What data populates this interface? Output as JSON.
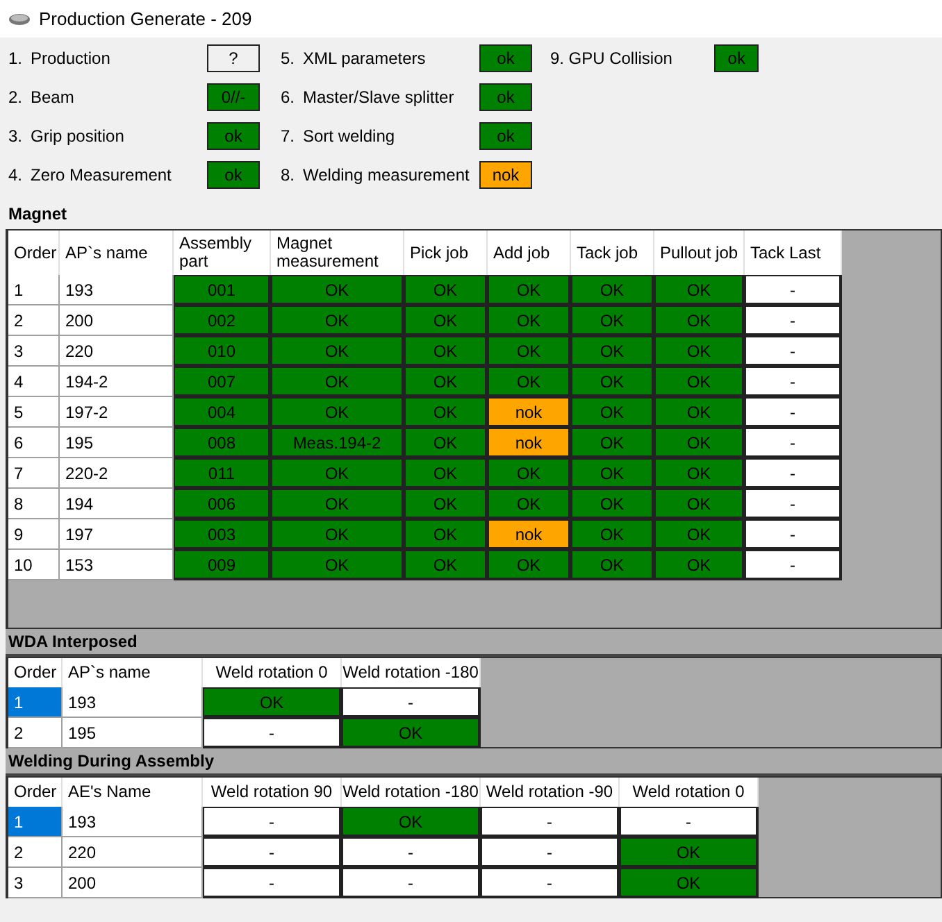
{
  "window": {
    "title": "Production Generate - 209"
  },
  "checks": [
    {
      "number": "1.",
      "label": "Production",
      "value": "?",
      "color": "#f0f0f0"
    },
    {
      "number": "2.",
      "label": "Beam",
      "value": "0//-",
      "color": "#008000"
    },
    {
      "number": "3.",
      "label": "Grip position",
      "value": "ok",
      "color": "#008000"
    },
    {
      "number": "4.",
      "label": "Zero Measurement",
      "value": "ok",
      "color": "#008000"
    },
    {
      "number": "5.",
      "label": "XML parameters",
      "value": "ok",
      "color": "#008000"
    },
    {
      "number": "6.",
      "label": "Master/Slave splitter",
      "value": "ok",
      "color": "#008000"
    },
    {
      "number": "7.",
      "label": "Sort welding",
      "value": "ok",
      "color": "#008000"
    },
    {
      "number": "8.",
      "label": "Welding measurement",
      "value": "nok",
      "color": "#ffa500"
    },
    {
      "number": "9.",
      "label": "GPU Collision",
      "value": "ok",
      "color": "#008000"
    }
  ],
  "sections": [
    {
      "title": "Magnet",
      "columns": [
        "Order",
        "AP`s name",
        "Assembly part",
        "Magnet measurement",
        "Pick job",
        "Add job",
        "Tack job",
        "Pullout job",
        "Tack Last"
      ],
      "rows": [
        {
          "selected": false,
          "cells": [
            {
              "text": "1"
            },
            {
              "text": "193"
            },
            {
              "text": "001",
              "color": "#008000"
            },
            {
              "text": "OK",
              "color": "#008000"
            },
            {
              "text": "OK",
              "color": "#008000"
            },
            {
              "text": "OK",
              "color": "#008000"
            },
            {
              "text": "OK",
              "color": "#008000"
            },
            {
              "text": "OK",
              "color": "#008000"
            },
            {
              "text": "-",
              "color": "#ffffff"
            }
          ]
        },
        {
          "selected": false,
          "cells": [
            {
              "text": "2"
            },
            {
              "text": "200"
            },
            {
              "text": "002",
              "color": "#008000"
            },
            {
              "text": "OK",
              "color": "#008000"
            },
            {
              "text": "OK",
              "color": "#008000"
            },
            {
              "text": "OK",
              "color": "#008000"
            },
            {
              "text": "OK",
              "color": "#008000"
            },
            {
              "text": "OK",
              "color": "#008000"
            },
            {
              "text": "-",
              "color": "#ffffff"
            }
          ]
        },
        {
          "selected": false,
          "cells": [
            {
              "text": "3"
            },
            {
              "text": "220"
            },
            {
              "text": "010",
              "color": "#008000"
            },
            {
              "text": "OK",
              "color": "#008000"
            },
            {
              "text": "OK",
              "color": "#008000"
            },
            {
              "text": "OK",
              "color": "#008000"
            },
            {
              "text": "OK",
              "color": "#008000"
            },
            {
              "text": "OK",
              "color": "#008000"
            },
            {
              "text": "-",
              "color": "#ffffff"
            }
          ]
        },
        {
          "selected": false,
          "cells": [
            {
              "text": "4"
            },
            {
              "text": "194-2"
            },
            {
              "text": "007",
              "color": "#008000"
            },
            {
              "text": "OK",
              "color": "#008000"
            },
            {
              "text": "OK",
              "color": "#008000"
            },
            {
              "text": "OK",
              "color": "#008000"
            },
            {
              "text": "OK",
              "color": "#008000"
            },
            {
              "text": "OK",
              "color": "#008000"
            },
            {
              "text": "-",
              "color": "#ffffff"
            }
          ]
        },
        {
          "selected": false,
          "cells": [
            {
              "text": "5"
            },
            {
              "text": "197-2"
            },
            {
              "text": "004",
              "color": "#008000"
            },
            {
              "text": "OK",
              "color": "#008000"
            },
            {
              "text": "OK",
              "color": "#008000"
            },
            {
              "text": "nok",
              "color": "#ffa500"
            },
            {
              "text": "OK",
              "color": "#008000"
            },
            {
              "text": "OK",
              "color": "#008000"
            },
            {
              "text": "-",
              "color": "#ffffff"
            }
          ]
        },
        {
          "selected": false,
          "cells": [
            {
              "text": "6"
            },
            {
              "text": "195"
            },
            {
              "text": "008",
              "color": "#008000"
            },
            {
              "text": "Meas.194-2",
              "color": "#008000"
            },
            {
              "text": "OK",
              "color": "#008000"
            },
            {
              "text": "nok",
              "color": "#ffa500"
            },
            {
              "text": "OK",
              "color": "#008000"
            },
            {
              "text": "OK",
              "color": "#008000"
            },
            {
              "text": "-",
              "color": "#ffffff"
            }
          ]
        },
        {
          "selected": false,
          "cells": [
            {
              "text": "7"
            },
            {
              "text": "220-2"
            },
            {
              "text": "011",
              "color": "#008000"
            },
            {
              "text": "OK",
              "color": "#008000"
            },
            {
              "text": "OK",
              "color": "#008000"
            },
            {
              "text": "OK",
              "color": "#008000"
            },
            {
              "text": "OK",
              "color": "#008000"
            },
            {
              "text": "OK",
              "color": "#008000"
            },
            {
              "text": "-",
              "color": "#ffffff"
            }
          ]
        },
        {
          "selected": false,
          "cells": [
            {
              "text": "8"
            },
            {
              "text": "194"
            },
            {
              "text": "006",
              "color": "#008000"
            },
            {
              "text": "OK",
              "color": "#008000"
            },
            {
              "text": "OK",
              "color": "#008000"
            },
            {
              "text": "OK",
              "color": "#008000"
            },
            {
              "text": "OK",
              "color": "#008000"
            },
            {
              "text": "OK",
              "color": "#008000"
            },
            {
              "text": "-",
              "color": "#ffffff"
            }
          ]
        },
        {
          "selected": false,
          "cells": [
            {
              "text": "9"
            },
            {
              "text": "197"
            },
            {
              "text": "003",
              "color": "#008000"
            },
            {
              "text": "OK",
              "color": "#008000"
            },
            {
              "text": "OK",
              "color": "#008000"
            },
            {
              "text": "nok",
              "color": "#ffa500"
            },
            {
              "text": "OK",
              "color": "#008000"
            },
            {
              "text": "OK",
              "color": "#008000"
            },
            {
              "text": "-",
              "color": "#ffffff"
            }
          ]
        },
        {
          "selected": false,
          "cells": [
            {
              "text": "10"
            },
            {
              "text": "153"
            },
            {
              "text": "009",
              "color": "#008000"
            },
            {
              "text": "OK",
              "color": "#008000"
            },
            {
              "text": "OK",
              "color": "#008000"
            },
            {
              "text": "OK",
              "color": "#008000"
            },
            {
              "text": "OK",
              "color": "#008000"
            },
            {
              "text": "OK",
              "color": "#008000"
            },
            {
              "text": "-",
              "color": "#ffffff"
            }
          ]
        }
      ]
    },
    {
      "title": "WDA Interposed",
      "columns": [
        "Order",
        "AP`s name",
        "Weld rotation 0",
        "Weld rotation -180"
      ],
      "rows": [
        {
          "selected": true,
          "cells": [
            {
              "text": "1"
            },
            {
              "text": "193"
            },
            {
              "text": "OK",
              "color": "#008000"
            },
            {
              "text": "-",
              "color": "#ffffff"
            }
          ]
        },
        {
          "selected": false,
          "cells": [
            {
              "text": "2"
            },
            {
              "text": "195"
            },
            {
              "text": "-",
              "color": "#ffffff"
            },
            {
              "text": "OK",
              "color": "#008000"
            }
          ]
        }
      ]
    },
    {
      "title": "Welding During Assembly",
      "columns": [
        "Order",
        "AE's Name",
        "Weld rotation 90",
        "Weld rotation -180",
        "Weld rotation -90",
        "Weld rotation 0"
      ],
      "rows": [
        {
          "selected": true,
          "cells": [
            {
              "text": "1"
            },
            {
              "text": "193"
            },
            {
              "text": "-",
              "color": "#ffffff"
            },
            {
              "text": "OK",
              "color": "#008000"
            },
            {
              "text": "-",
              "color": "#ffffff"
            },
            {
              "text": "-",
              "color": "#ffffff"
            }
          ]
        },
        {
          "selected": false,
          "cells": [
            {
              "text": "2"
            },
            {
              "text": "220"
            },
            {
              "text": "-",
              "color": "#ffffff"
            },
            {
              "text": "-",
              "color": "#ffffff"
            },
            {
              "text": "-",
              "color": "#ffffff"
            },
            {
              "text": "OK",
              "color": "#008000"
            }
          ]
        },
        {
          "selected": false,
          "cells": [
            {
              "text": "3"
            },
            {
              "text": "200"
            },
            {
              "text": "-",
              "color": "#ffffff"
            },
            {
              "text": "-",
              "color": "#ffffff"
            },
            {
              "text": "-",
              "color": "#ffffff"
            },
            {
              "text": "OK",
              "color": "#008000"
            }
          ]
        }
      ]
    }
  ]
}
